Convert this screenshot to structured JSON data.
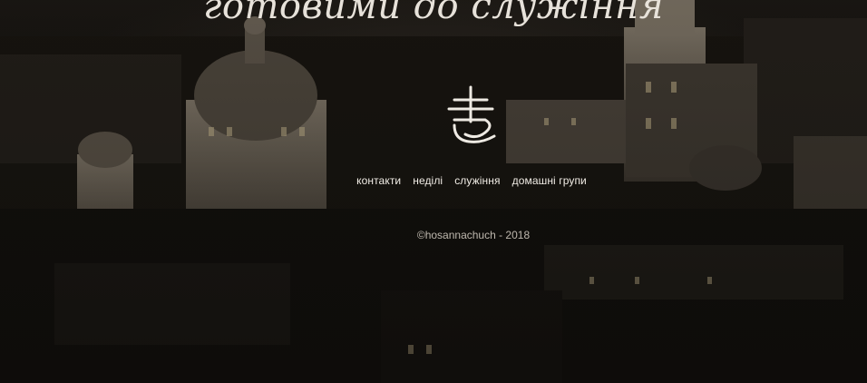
{
  "hero": {
    "tagline": "готовими до служіння"
  },
  "logo": {
    "icon": "church-logo-icon"
  },
  "nav": {
    "items": [
      {
        "label": "контакти"
      },
      {
        "label": "неділі"
      },
      {
        "label": "служіння"
      },
      {
        "label": "домашні групи"
      }
    ]
  },
  "footer": {
    "copyright": "©hosannachuch - 2018"
  },
  "colors": {
    "background": "#0d0b09",
    "text": "#f1ede6",
    "muted_text": "#bdb7ad"
  }
}
